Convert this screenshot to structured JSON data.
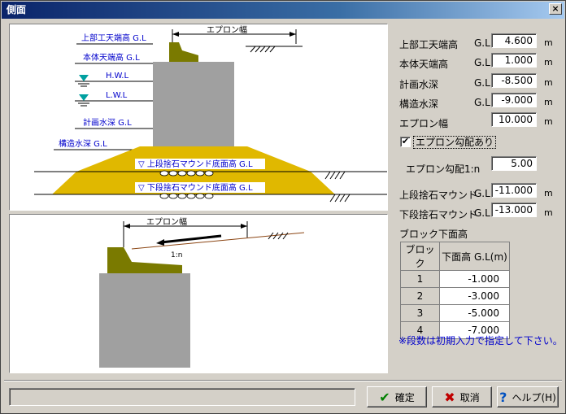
{
  "window": {
    "title": "側面",
    "close": "×"
  },
  "diagram_top": {
    "apron_width_label": "エプロン幅",
    "top_work_label": "上部工天端高 G.L",
    "body_top_label": "本体天端高 G.L",
    "hwl_label": "H.W.L",
    "lwl_label": "L.W.L",
    "plan_depth_label": "計画水深 G.L",
    "struct_depth_label": "構造水深 G.L",
    "upper_mound_label": "▽ 上段捨石マウンド底面高 G.L",
    "lower_mound_label": "▽ 下段捨石マウンド底面高 G.L"
  },
  "diagram_bottom": {
    "apron_width_label": "エプロン幅",
    "slope_label": "1:n"
  },
  "form": {
    "top_work": {
      "label": "上部工天端高",
      "prefix": "G.L",
      "value": "4.600",
      "unit": "m"
    },
    "body_top": {
      "label": "本体天端高",
      "prefix": "G.L",
      "value": "1.000",
      "unit": "m"
    },
    "plan_depth": {
      "label": "計画水深",
      "prefix": "G.L",
      "value": "-8.500",
      "unit": "m"
    },
    "struct_depth": {
      "label": "構造水深",
      "prefix": "G.L",
      "value": "-9.000",
      "unit": "m"
    },
    "apron_width": {
      "label": "エプロン幅",
      "value": "10.000",
      "unit": "m"
    },
    "apron_slope_check": {
      "label": "エプロン勾配あり",
      "checked": "✔"
    },
    "apron_slope": {
      "label": "エプロン勾配1:n",
      "value": "5.00"
    },
    "upper_mound": {
      "label": "上段捨石マウンド",
      "prefix": "G.L",
      "value": "-11.000",
      "unit": "m"
    },
    "lower_mound": {
      "label": "下段捨石マウンド",
      "prefix": "G.L",
      "value": "-13.000",
      "unit": "m"
    }
  },
  "block_table": {
    "title": "ブロック下面高",
    "headers": [
      "ブロック",
      "下面高 G.L(m)"
    ],
    "rows": [
      {
        "idx": "1",
        "value": "-1.000"
      },
      {
        "idx": "2",
        "value": "-3.000"
      },
      {
        "idx": "3",
        "value": "-5.000"
      },
      {
        "idx": "4",
        "value": "-7.000"
      }
    ]
  },
  "note": "※段数は初期入力で指定して下さい。",
  "buttons": {
    "ok": {
      "label": "確定",
      "icon": "✔"
    },
    "cancel": {
      "label": "取消",
      "icon": "✖"
    },
    "help": {
      "label": "ヘルプ(H)",
      "icon": "?"
    }
  },
  "colors": {
    "concrete": "#a0a0a0",
    "cap": "#7a7a00",
    "mound": "#e0b800",
    "label_blue": "#0000cc"
  }
}
